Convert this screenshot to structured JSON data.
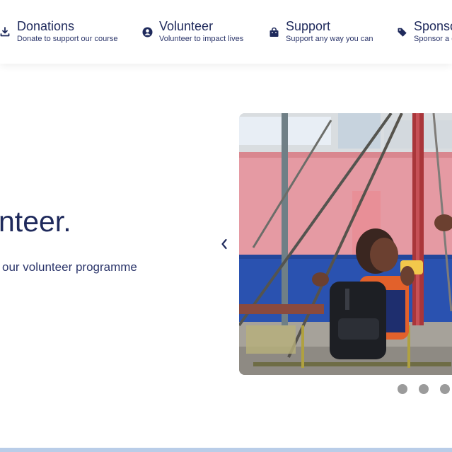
{
  "nav": {
    "items": [
      {
        "title": "Donations",
        "subtitle": "Donate to support our course",
        "icon": "download-icon"
      },
      {
        "title": "Volunteer",
        "subtitle": "Volunteer to impact lives",
        "icon": "user-circle-icon"
      },
      {
        "title": "Support",
        "subtitle": "Support any way you can",
        "icon": "shopping-bag-icon"
      },
      {
        "title": "Sponso",
        "subtitle": "Sponsor a c",
        "icon": "tag-icon"
      }
    ]
  },
  "hero": {
    "title": "nteer.",
    "subtitle": "our volunteer programme"
  },
  "carousel": {
    "prev_icon": "chevron-left-icon",
    "slide_description": "photo of child on a playground swing",
    "dots_count": 3
  },
  "colors": {
    "text_dark": "#1f2a5c",
    "dot": "#9b9b9b",
    "bottom_strip": "#b9cde8"
  }
}
